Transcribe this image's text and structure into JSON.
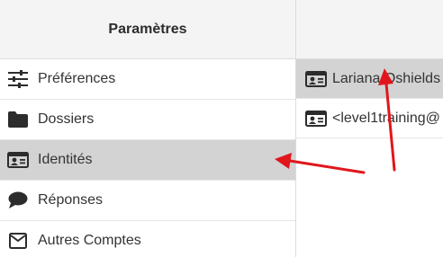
{
  "settings": {
    "title": "Paramètres",
    "items": [
      {
        "label": "Préférences",
        "icon": "sliders-icon"
      },
      {
        "label": "Dossiers",
        "icon": "folder-icon"
      },
      {
        "label": "Identités",
        "icon": "id-card-icon",
        "selected": true
      },
      {
        "label": "Réponses",
        "icon": "speech-bubble-icon"
      },
      {
        "label": "Autres Comptes",
        "icon": "envelope-icon"
      }
    ]
  },
  "identities": {
    "items": [
      {
        "label": "Lariana Oshields",
        "icon": "id-card-icon",
        "selected": true
      },
      {
        "label": "<level1training@",
        "icon": "id-card-icon"
      }
    ]
  },
  "annotations": {
    "arrow_color": "#e0161c"
  },
  "colors": {
    "selected_bg": "#d3d3d3",
    "header_bg": "#f4f4f4",
    "text": "#333333"
  }
}
